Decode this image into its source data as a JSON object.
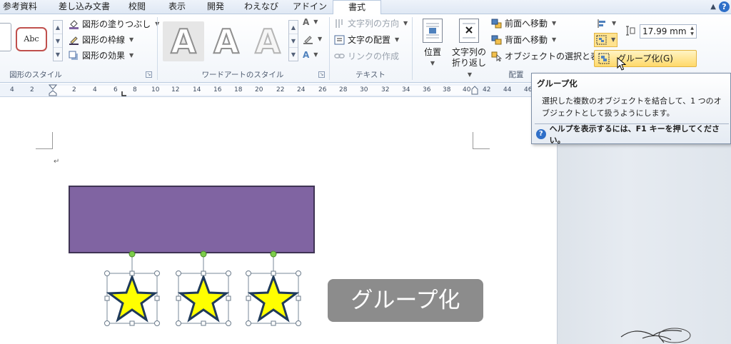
{
  "tabs": [
    {
      "label": "参考資料",
      "active": false
    },
    {
      "label": "差し込み文書",
      "active": false
    },
    {
      "label": "校閲",
      "active": false
    },
    {
      "label": "表示",
      "active": false
    },
    {
      "label": "開発",
      "active": false
    },
    {
      "label": "わえなび",
      "active": false
    },
    {
      "label": "アドイン",
      "active": false
    },
    {
      "label": "書式",
      "active": true
    }
  ],
  "ribbon": {
    "shape_styles": {
      "sample_label": "Abc",
      "fill_label": "図形の塗りつぶし",
      "outline_label": "図形の枠線",
      "effects_label": "図形の効果",
      "group_label": "図形のスタイル"
    },
    "wordart": {
      "letter": "A",
      "group_label": "ワードアートのスタイル"
    },
    "text": {
      "direction_label": "文字列の方向",
      "align_label": "文字の配置",
      "link_label": "リンクの作成",
      "group_label": "テキスト"
    },
    "arrange": {
      "position_label": "位置",
      "wrap_label_line1": "文字列の",
      "wrap_label_line2": "折り返し",
      "bring_forward_label": "前面へ移動",
      "send_backward_label": "背面へ移動",
      "selection_pane_label": "オブジェクトの選択と表示",
      "group_label": "配置"
    },
    "size": {
      "height_value": "17.99 mm"
    }
  },
  "ruler": {
    "numbers": [
      "4",
      "2",
      "2",
      "4",
      "6",
      "8",
      "10",
      "12",
      "14",
      "16",
      "18",
      "20",
      "22",
      "24",
      "26",
      "28",
      "30",
      "32",
      "34",
      "36",
      "38",
      "40",
      "42",
      "44",
      "46"
    ]
  },
  "menu": {
    "group_item_label": "グループ化(G)"
  },
  "tooltip": {
    "title": "グループ化",
    "body": "選択した複数のオブジェクトを結合して、1 つのオブジェクトとして扱うようにします。",
    "help_text": "ヘルプを表示するには、F1 キーを押してください。"
  },
  "document": {
    "caption": "グループ化",
    "star_count": 3
  },
  "colors": {
    "rectangle_fill": "#8064a2",
    "star_fill": "#ffff00",
    "caption_bg": "#8c8c8c",
    "menu_highlight": "#ffd96a"
  }
}
